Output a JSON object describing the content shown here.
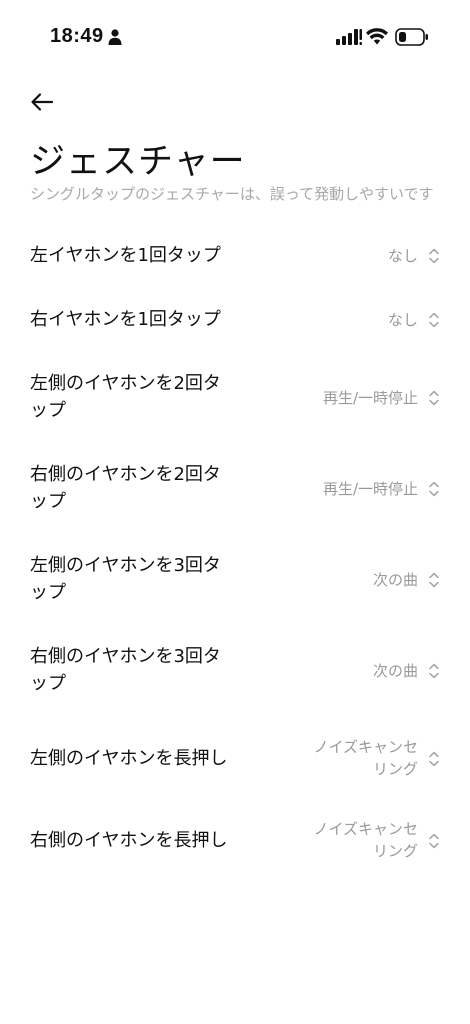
{
  "status_bar": {
    "time": "18:49",
    "icons": [
      "person-icon",
      "signal-icon",
      "wifi-icon",
      "battery-icon"
    ]
  },
  "header": {
    "back_icon": "arrow-left-icon",
    "title": "ジェスチャー",
    "description": "シングルタップのジェスチャーは、誤って発動しやすいです"
  },
  "settings": [
    {
      "label": "左イヤホンを1回タップ",
      "value": "なし"
    },
    {
      "label": "右イヤホンを1回タップ",
      "value": "なし"
    },
    {
      "label": "左側のイヤホンを2回タップ",
      "value": "再生/一時停止"
    },
    {
      "label": "右側のイヤホンを2回タップ",
      "value": "再生/一時停止"
    },
    {
      "label": "左側のイヤホンを3回タップ",
      "value": "次の曲"
    },
    {
      "label": "右側のイヤホンを3回タップ",
      "value": "次の曲"
    },
    {
      "label": "左側のイヤホンを長押し",
      "value": "ノイズキャンセリング"
    },
    {
      "label": "右側のイヤホンを長押し",
      "value": "ノイズキャンセリング"
    }
  ],
  "colors": {
    "text_primary": "#111111",
    "text_secondary": "#9a9a9a",
    "background": "#ffffff"
  }
}
